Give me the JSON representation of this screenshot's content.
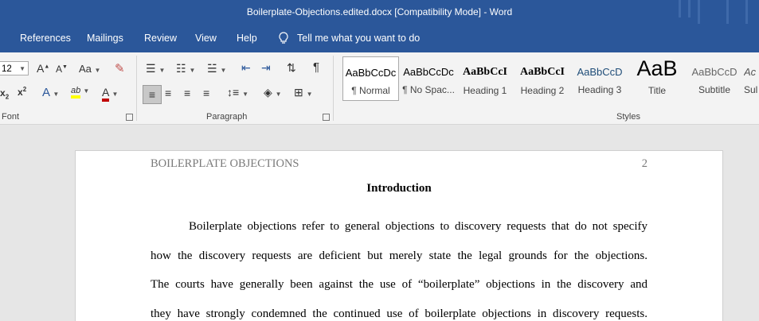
{
  "titlebar": {
    "title": "Boilerplate-Objections.edited.docx [Compatibility Mode]  -  Word"
  },
  "tabs": [
    {
      "label": "References"
    },
    {
      "label": "Mailings"
    },
    {
      "label": "Review"
    },
    {
      "label": "View"
    },
    {
      "label": "Help"
    }
  ],
  "tell_me": {
    "label": "Tell me what you want to do"
  },
  "font_group": {
    "size": "12",
    "label": "Font",
    "grow_label": "A",
    "shrink_label": "A",
    "case_label": "Aa",
    "subscript_label": "x",
    "superscript_label": "x",
    "effects_label": "A",
    "highlight_label": "ab",
    "font_color_label": "A"
  },
  "paragraph_group": {
    "label": "Paragraph"
  },
  "styles_group": {
    "label": "Styles",
    "items": [
      {
        "preview": "AaBbCcDc",
        "name": "¶ Normal"
      },
      {
        "preview": "AaBbCcDc",
        "name": "¶ No Spac..."
      },
      {
        "preview": "AaBbCcI",
        "name": "Heading 1"
      },
      {
        "preview": "AaBbCcI",
        "name": "Heading 2"
      },
      {
        "preview": "AaBbCcD",
        "name": "Heading 3"
      },
      {
        "preview": "AaB",
        "name": "Title"
      },
      {
        "preview": "AaBbCcD",
        "name": "Subtitle"
      },
      {
        "preview": "Ac",
        "name": "Sul"
      }
    ]
  },
  "colors": {
    "accent": "#2b579a",
    "highlight": "#ffff00",
    "font_color": "#c00000"
  },
  "document": {
    "header_text": "BOILERPLATE OBJECTIONS",
    "page_number": "2",
    "heading": "Introduction",
    "lines": [
      "Boilerplate objections refer to general objections to discovery requests that do not specify",
      "how the discovery requests are deficient but merely state the legal grounds for the objections.",
      "The courts have generally been against the use of “boilerplate” objections in the discovery and",
      "they have strongly condemned the continued use of boilerplate objections in discovery requests."
    ]
  }
}
